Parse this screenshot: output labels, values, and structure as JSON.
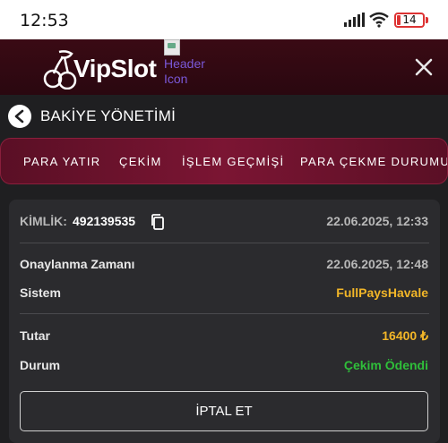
{
  "status_bar": {
    "time": "12:53",
    "battery": "14"
  },
  "header": {
    "brand": "VipSlot",
    "header_icon_alt": "Header Icon"
  },
  "page": {
    "title": "BAKİYE YÖNETİMİ"
  },
  "tabs": [
    {
      "label": "PARA YATIR"
    },
    {
      "label": "ÇEKİM"
    },
    {
      "label": "İŞLEM GEÇMİŞİ"
    },
    {
      "label": "PARA ÇEKME DURUMU"
    }
  ],
  "transaction": {
    "id_label": "KİMLİK:",
    "id_value": "492139535",
    "created": "22.06.2025, 12:33",
    "approval_label": "Onaylanma Zamanı",
    "approval_value": "22.06.2025, 12:48",
    "system_label": "Sistem",
    "system_value": "FullPaysHavale",
    "amount_label": "Tutar",
    "amount_value": "16400 ₺",
    "status_label": "Durum",
    "status_value": "Çekim Ödendi",
    "cancel_label": "İPTAL ET"
  },
  "colors": {
    "accent_gold": "#f2b628",
    "status_green": "#2fbf3a",
    "tab_bar": "#7b1533",
    "header_bg": "#3a0a14"
  }
}
